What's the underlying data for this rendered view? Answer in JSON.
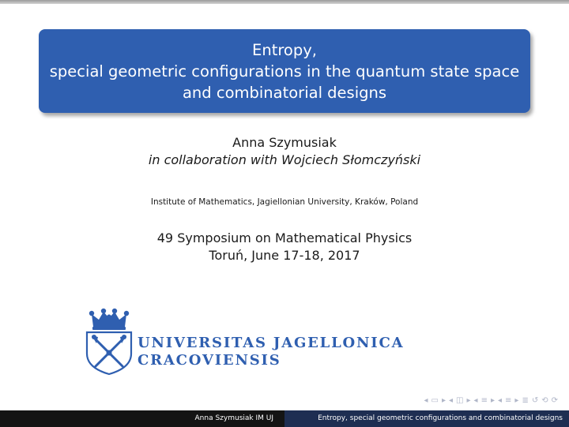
{
  "title": {
    "line1": "Entropy,",
    "line2": "special geometric configurations in the quantum state space",
    "line3": "and combinatorial designs"
  },
  "author": "Anna Szymusiak",
  "collaboration": "in collaboration with Wojciech Słomczyński",
  "institute": "Institute of Mathematics, Jagiellonian University, Kraków, Poland",
  "conference": "49 Symposium on Mathematical Physics",
  "location_date": "Toruń, June 17-18, 2017",
  "logo": {
    "line1": "UNIVERSITAS JAGELLONICA",
    "line2": "CRACOVIENSIS",
    "icon": "jagiellonian-crest-icon"
  },
  "footer": {
    "author_short": "Anna Szymusiak IM UJ",
    "title_short": "Entropy, special geometric configurations and combinatorial designs"
  },
  "colors": {
    "accent": "#2f5fb0",
    "footer_dark": "#141414",
    "footer_blue": "#1e2e52"
  }
}
